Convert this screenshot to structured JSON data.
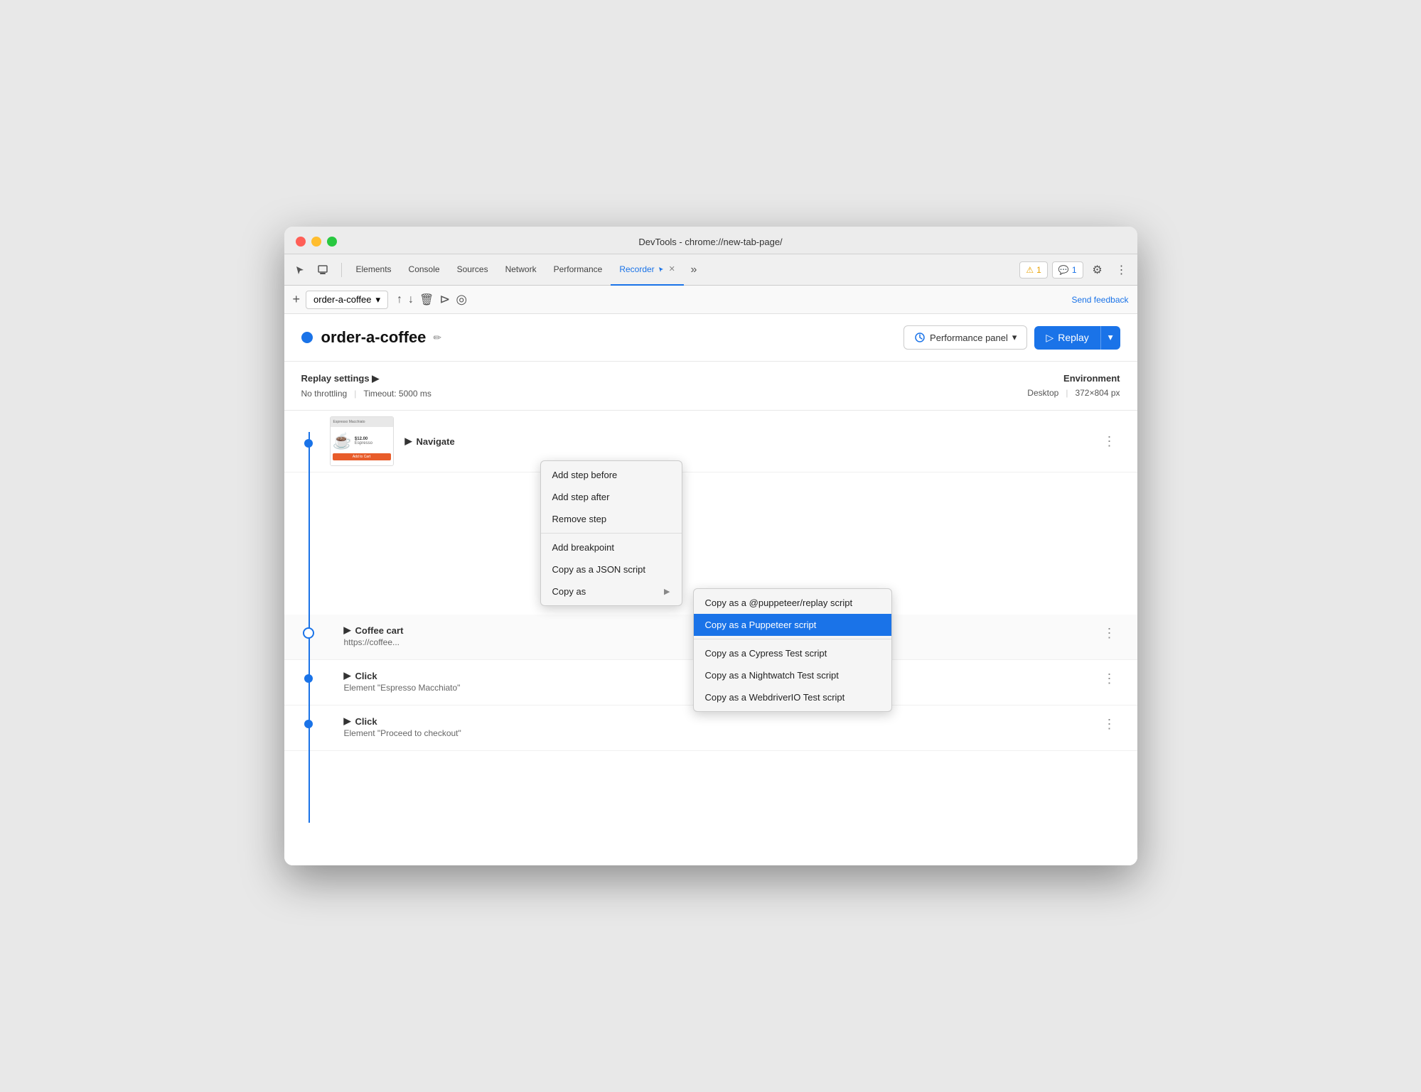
{
  "window": {
    "title": "DevTools - chrome://new-tab-page/"
  },
  "tabs_bar": {
    "tabs": [
      {
        "label": "Elements",
        "active": false
      },
      {
        "label": "Console",
        "active": false
      },
      {
        "label": "Sources",
        "active": false
      },
      {
        "label": "Network",
        "active": false
      },
      {
        "label": "Performance",
        "active": false
      },
      {
        "label": "Recorder",
        "active": true
      }
    ],
    "more_icon": "≫",
    "warning_badge": "⚠ 1",
    "chat_badge": "💬 1",
    "settings_icon": "⚙",
    "more_dots_icon": "⋮"
  },
  "secondary_toolbar": {
    "add_icon": "+",
    "recording_name": "order-a-coffee",
    "dropdown_arrow": "▾",
    "upload_icon": "↑",
    "download_icon": "↓",
    "delete_icon": "🗑",
    "start_icon": "▷",
    "settings_icon": "⌀",
    "send_feedback": "Send feedback"
  },
  "recording_header": {
    "name": "order-a-coffee",
    "edit_icon": "✏",
    "perf_panel_label": "Performance panel",
    "perf_panel_dropdown": "▾",
    "replay_label": "Replay",
    "replay_dropdown": "▾"
  },
  "replay_settings": {
    "title": "Replay settings ▶",
    "throttling": "No throttling",
    "timeout": "Timeout: 5000 ms",
    "separator": "|"
  },
  "environment": {
    "title": "Environment",
    "device": "Desktop",
    "resolution": "372×804 px",
    "separator": "|"
  },
  "steps": [
    {
      "type": "navigate",
      "label": "Navigate",
      "has_thumbnail": true,
      "subtitle": "",
      "dot_type": "filled",
      "bold": false
    },
    {
      "type": "coffee-cart",
      "label": "Coffee cart",
      "has_thumbnail": false,
      "subtitle": "https://coffee...",
      "dot_type": "outline",
      "bold": true
    },
    {
      "type": "click",
      "label": "Click",
      "has_thumbnail": false,
      "subtitle": "Element \"Espresso Macchiato\"",
      "dot_type": "filled",
      "bold": false
    },
    {
      "type": "click2",
      "label": "Click",
      "has_thumbnail": false,
      "subtitle": "Element \"Proceed to checkout\"",
      "dot_type": "filled",
      "bold": false
    }
  ],
  "context_menu_primary": {
    "items": [
      {
        "label": "Add step before",
        "has_submenu": false,
        "separator_after": false
      },
      {
        "label": "Add step after",
        "has_submenu": false,
        "separator_after": false
      },
      {
        "label": "Remove step",
        "has_submenu": false,
        "separator_after": true
      },
      {
        "label": "Add breakpoint",
        "has_submenu": false,
        "separator_after": false
      },
      {
        "label": "Copy as a JSON script",
        "has_submenu": false,
        "separator_after": false
      },
      {
        "label": "Copy as",
        "has_submenu": true,
        "separator_after": false
      }
    ]
  },
  "context_menu_secondary": {
    "items": [
      {
        "label": "Copy as a @puppeteer/replay script",
        "highlighted": false
      },
      {
        "label": "Copy as a Puppeteer script",
        "highlighted": true
      },
      {
        "label": "Copy as a Cypress Test script",
        "highlighted": false
      },
      {
        "label": "Copy as a Nightwatch Test script",
        "highlighted": false
      },
      {
        "label": "Copy as a WebdriverIO Test script",
        "highlighted": false
      }
    ]
  }
}
